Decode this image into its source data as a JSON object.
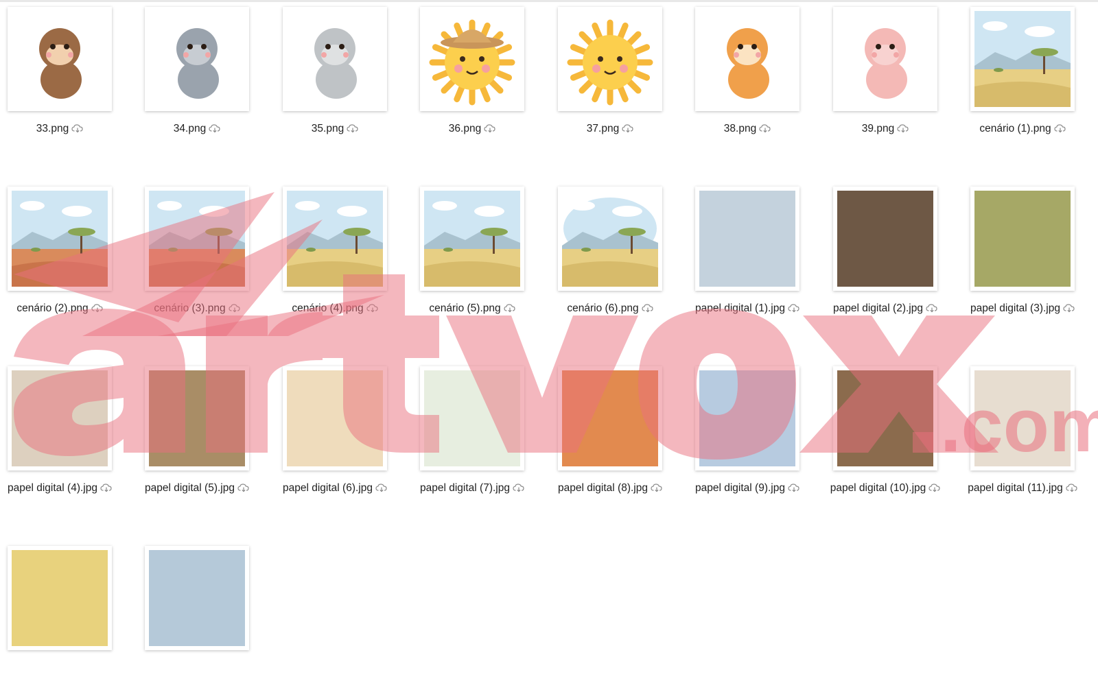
{
  "watermark": {
    "text": "artvox.com",
    "color": "#ea6f7d"
  },
  "files": [
    {
      "name": "33.png",
      "kind": "monkey"
    },
    {
      "name": "34.png",
      "kind": "hippo"
    },
    {
      "name": "35.png",
      "kind": "rhino"
    },
    {
      "name": "36.png",
      "kind": "sun-hat"
    },
    {
      "name": "37.png",
      "kind": "sun"
    },
    {
      "name": "38.png",
      "kind": "tiger"
    },
    {
      "name": "39.png",
      "kind": "flamingo"
    },
    {
      "name": "cenário (1).png",
      "kind": "savanna"
    },
    {
      "name": "cenário (2).png",
      "kind": "savanna-red"
    },
    {
      "name": "cenário (3).png",
      "kind": "savanna-red"
    },
    {
      "name": "cenário (4).png",
      "kind": "savanna"
    },
    {
      "name": "cenário (5).png",
      "kind": "savanna"
    },
    {
      "name": "cenário (6).png",
      "kind": "savanna-soft"
    },
    {
      "name": "papel digital (1).jpg",
      "kind": "paper",
      "color": "#c4d2dd"
    },
    {
      "name": "papel digital (2).jpg",
      "kind": "paper",
      "color": "#6e5845"
    },
    {
      "name": "papel digital (3).jpg",
      "kind": "paper",
      "color": "#a6a866"
    },
    {
      "name": "papel digital (4).jpg",
      "kind": "paper",
      "color": "#ddd0bf"
    },
    {
      "name": "papel digital (5).jpg",
      "kind": "paper",
      "color": "#a98d66"
    },
    {
      "name": "papel digital (6).jpg",
      "kind": "paper",
      "color": "#efdcbc"
    },
    {
      "name": "papel digital (7).jpg",
      "kind": "paper",
      "color": "#e7eee0"
    },
    {
      "name": "papel digital (8).jpg",
      "kind": "paper",
      "color": "#e28a4f"
    },
    {
      "name": "papel digital (9).jpg",
      "kind": "paper",
      "color": "#b7cbe0"
    },
    {
      "name": "papel digital (10).jpg",
      "kind": "paper",
      "color": "#8b6b4d"
    },
    {
      "name": "papel digital (11).jpg",
      "kind": "paper",
      "color": "#e7ddd0"
    },
    {
      "name": "",
      "kind": "paper",
      "color": "#e8d27d"
    },
    {
      "name": "",
      "kind": "paper",
      "color": "#b5c9d9"
    }
  ]
}
